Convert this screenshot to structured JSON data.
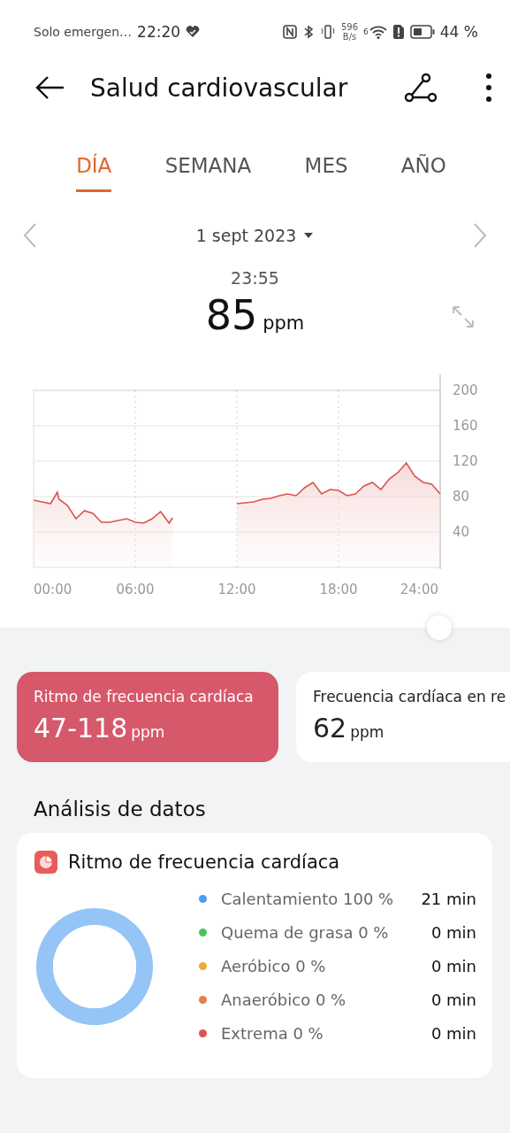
{
  "status_bar": {
    "carrier": "Solo emergen…",
    "time": "22:20",
    "net_speed_value": "596",
    "net_speed_unit": "B/s",
    "signal_label": "6",
    "battery": "44 %"
  },
  "header": {
    "title": "Salud cardiovascular"
  },
  "tabs": [
    {
      "label": "DÍA",
      "selected": true
    },
    {
      "label": "SEMANA",
      "selected": false
    },
    {
      "label": "MES",
      "selected": false
    },
    {
      "label": "AÑO",
      "selected": false
    }
  ],
  "date": "1 sept 2023",
  "reading": {
    "time": "23:55",
    "value": "85",
    "unit": "ppm"
  },
  "chart_data": {
    "type": "area",
    "grid": true,
    "x": [
      0,
      0.5,
      1,
      1.4,
      1.5,
      2,
      2.5,
      3,
      3.5,
      4,
      4.5,
      5,
      5.5,
      6,
      6.5,
      7,
      7.5,
      8,
      8.2,
      12,
      12.5,
      13,
      13.5,
      14,
      14.5,
      15,
      15.5,
      16,
      16.5,
      17,
      17.5,
      18,
      18.5,
      19,
      19.5,
      20,
      20.5,
      21,
      21.5,
      22,
      22.5,
      23,
      23.5,
      24
    ],
    "series": [
      {
        "color": "#d9544f",
        "values": [
          76,
          74,
          72,
          85,
          77,
          70,
          55,
          64,
          61,
          51,
          51,
          53,
          55,
          51,
          50,
          55,
          63,
          50,
          56,
          72,
          73,
          74,
          77,
          78,
          81,
          83,
          81,
          90,
          96,
          83,
          88,
          87,
          81,
          83,
          92,
          96,
          88,
          100,
          107,
          118,
          103,
          96,
          94,
          83
        ]
      }
    ],
    "xlim": [
      0,
      24
    ],
    "ylim": [
      0,
      200
    ],
    "xticks": [
      {
        "value": 0,
        "label": "00:00"
      },
      {
        "value": 6,
        "label": "06:00"
      },
      {
        "value": 12,
        "label": "12:00"
      },
      {
        "value": 18,
        "label": "18:00"
      },
      {
        "value": 24,
        "label": "24:00"
      }
    ],
    "yticks": [
      40,
      80,
      120,
      160,
      200
    ]
  },
  "summary_cards": [
    {
      "label": "Ritmo de frecuencia cardíaca",
      "value": "47-118",
      "unit": "ppm",
      "selected": true
    },
    {
      "label": "Frecuencia cardíaca en re",
      "value": "62",
      "unit": "ppm",
      "selected": false
    }
  ],
  "section_title": "Análisis de datos",
  "analysis_card": {
    "title": "Ritmo de frecuencia cardíaca",
    "chart_data": {
      "type": "donut",
      "values": [
        100,
        0,
        0,
        0,
        0
      ]
    },
    "zones": [
      {
        "label": "Calentamiento 100 %",
        "duration": "21 min",
        "color": "#4f9cf0"
      },
      {
        "label": "Quema de grasa 0 %",
        "duration": "0 min",
        "color": "#4cc35a"
      },
      {
        "label": "Aeróbico 0 %",
        "duration": "0 min",
        "color": "#f0a83a"
      },
      {
        "label": "Anaeróbico 0 %",
        "duration": "0 min",
        "color": "#e87c4a"
      },
      {
        "label": "Extrema 0 %",
        "duration": "0 min",
        "color": "#e05252"
      }
    ]
  }
}
